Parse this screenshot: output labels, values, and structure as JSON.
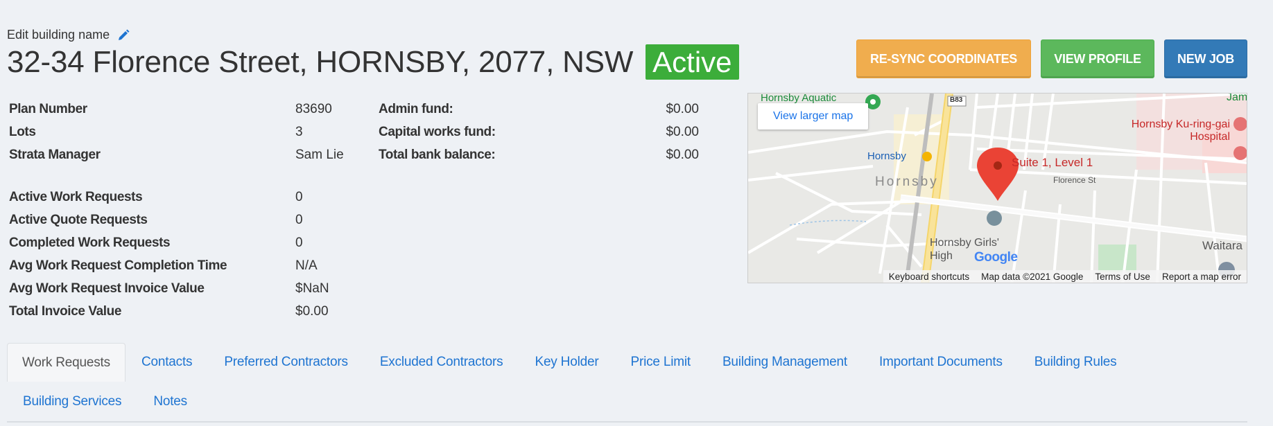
{
  "header": {
    "edit_label": "Edit building name",
    "title": "32-34 Florence Street, HORNSBY, 2077, NSW",
    "status": "Active"
  },
  "actions": {
    "resync": "RE-SYNC COORDINATES",
    "view_profile": "VIEW PROFILE",
    "new_job": "NEW JOB"
  },
  "details": [
    {
      "label": "Plan Number",
      "value": "83690"
    },
    {
      "label": "Lots",
      "value": "3"
    },
    {
      "label": "Strata Manager",
      "value": "Sam Lie"
    }
  ],
  "stats": [
    {
      "label": "Active Work Requests",
      "value": "0"
    },
    {
      "label": "Active Quote Requests",
      "value": "0"
    },
    {
      "label": "Completed Work Requests",
      "value": "0"
    },
    {
      "label": "Avg Work Request Completion Time",
      "value": "N/A"
    },
    {
      "label": "Avg Work Request Invoice Value",
      "value": "$NaN"
    },
    {
      "label": "Total Invoice Value",
      "value": "$0.00"
    }
  ],
  "funds": [
    {
      "label": "Admin fund:",
      "value": "$0.00"
    },
    {
      "label": "Capital works fund:",
      "value": "$0.00"
    },
    {
      "label": "Total bank balance:",
      "value": "$0.00"
    }
  ],
  "map": {
    "view_larger": "View larger map",
    "marker_label": "Suite 1, Level 1",
    "place_labels": {
      "aquatic": "Hornsby Aquatic",
      "hornsby_station": "Hornsby",
      "hornsby_area": "Hornsby",
      "hospital": "Hornsby Ku-ring-gai Hospital",
      "school": "Hornsby Girls' High",
      "waitara": "Waitara",
      "jam": "Jam",
      "florence": "Florence St",
      "b83": "B83"
    },
    "footer": {
      "shortcuts": "Keyboard shortcuts",
      "data": "Map data ©2021 Google",
      "terms": "Terms of Use",
      "report": "Report a map error"
    },
    "logo": "Google"
  },
  "tabs": [
    {
      "label": "Work Requests",
      "active": true
    },
    {
      "label": "Contacts"
    },
    {
      "label": "Preferred Contractors"
    },
    {
      "label": "Excluded Contractors"
    },
    {
      "label": "Key Holder"
    },
    {
      "label": "Price Limit"
    },
    {
      "label": "Building Management"
    },
    {
      "label": "Important Documents"
    },
    {
      "label": "Building Rules"
    }
  ],
  "tabs_row2": [
    {
      "label": "Building Services"
    },
    {
      "label": "Notes"
    }
  ],
  "colors": {
    "active_badge": "#3cad3a",
    "resync": "#f0ad4e",
    "view_profile": "#5cb85c",
    "new_job": "#337ab7",
    "tab_link": "#1e74d1"
  }
}
